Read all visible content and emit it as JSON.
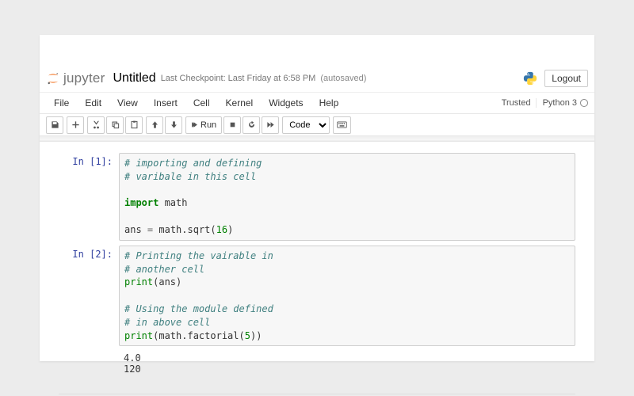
{
  "header": {
    "wordmark": "jupyter",
    "notebook_name": "Untitled",
    "checkpoint": "Last Checkpoint: Last Friday at 6:58 PM",
    "autosave": "(autosaved)",
    "logout": "Logout"
  },
  "menubar": {
    "items": [
      "File",
      "Edit",
      "View",
      "Insert",
      "Cell",
      "Kernel",
      "Widgets",
      "Help"
    ],
    "trusted": "Trusted",
    "kernel": "Python 3"
  },
  "toolbar": {
    "run_label": "Run",
    "celltype": "Code"
  },
  "cells": [
    {
      "prompt": "In [1]:",
      "lines": [
        {
          "t": "comment",
          "text": "# importing and defining"
        },
        {
          "t": "comment",
          "text": "# varibale in this cell"
        },
        {
          "t": "blank",
          "text": ""
        },
        {
          "t": "import",
          "kw": "import",
          "rest": " math"
        },
        {
          "t": "blank",
          "text": ""
        },
        {
          "t": "assign",
          "lhs": "ans ",
          "op": "=",
          "rhs_pre": " math.sqrt(",
          "num": "16",
          "rhs_post": ")"
        }
      ]
    },
    {
      "prompt": "In [2]:",
      "lines": [
        {
          "t": "comment",
          "text": "# Printing the vairable in"
        },
        {
          "t": "comment",
          "text": "# another cell"
        },
        {
          "t": "call",
          "fn": "print",
          "open": "(",
          "arg": "ans",
          "close": ")"
        },
        {
          "t": "blank",
          "text": ""
        },
        {
          "t": "comment",
          "text": "# Using the module defined"
        },
        {
          "t": "comment",
          "text": "# in above cell"
        },
        {
          "t": "call",
          "fn": "print",
          "open": "(",
          "arg_pre": "math.factorial(",
          "num": "5",
          "arg_post": ")",
          "close": ")"
        }
      ],
      "output": "4.0\n120"
    }
  ]
}
